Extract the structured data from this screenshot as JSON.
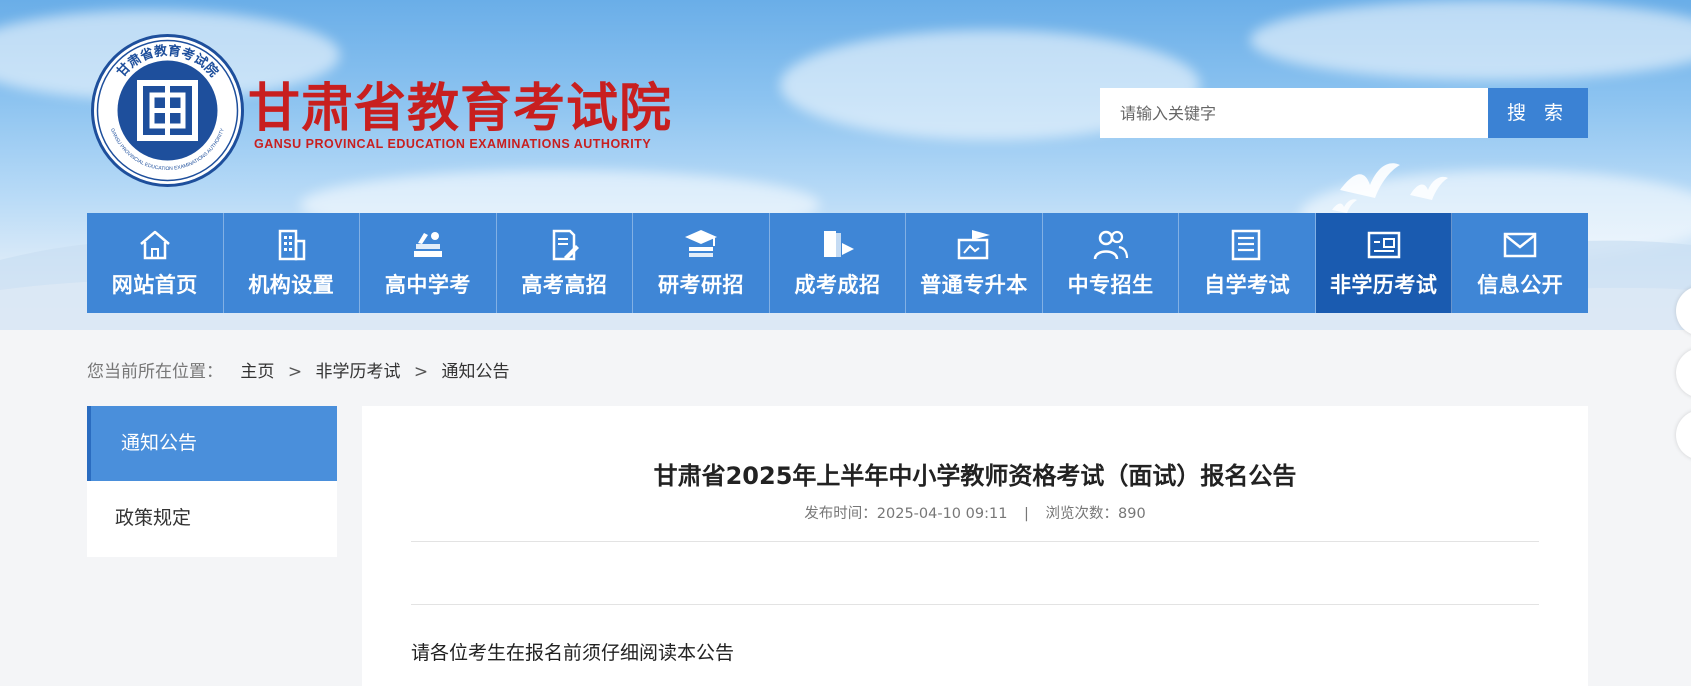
{
  "header": {
    "site_title": "甘肃省教育考试院",
    "site_subtitle": "GANSU PROVINCAL EDUCATION EXAMINATIONS AUTHORITY",
    "logo_ring_text": "甘肃省教育考试院",
    "logo_ring_text_en": "GANSU PROVINCIAL EDUCATION EXAMINATIONS AUTHORITY",
    "search": {
      "placeholder": "请输入关键字",
      "button_label": "搜 索"
    }
  },
  "nav": {
    "items": [
      {
        "label": "网站首页",
        "icon": "home-icon"
      },
      {
        "label": "机构设置",
        "icon": "building-icon"
      },
      {
        "label": "高中学考",
        "icon": "books-icon"
      },
      {
        "label": "高考高招",
        "icon": "document-pen-icon"
      },
      {
        "label": "研考研招",
        "icon": "graduation-cap-icon"
      },
      {
        "label": "成考成招",
        "icon": "book-flag-icon"
      },
      {
        "label": "普通专升本",
        "icon": "cap-screen-icon"
      },
      {
        "label": "中专招生",
        "icon": "users-icon"
      },
      {
        "label": "自学考试",
        "icon": "notebook-icon"
      },
      {
        "label": "非学历考试",
        "icon": "card-icon",
        "active": true
      },
      {
        "label": "信息公开",
        "icon": "mail-icon"
      }
    ]
  },
  "breadcrumb": {
    "prefix": "您当前所在位置：",
    "items": [
      "主页",
      "非学历考试",
      "通知公告"
    ],
    "separator": ">"
  },
  "sidebar": {
    "items": [
      {
        "label": "通知公告",
        "active": true
      },
      {
        "label": "政策规定"
      }
    ]
  },
  "article": {
    "title": "甘肃省2025年上半年中小学教师资格考试（面试）报名公告",
    "publish_label": "发布时间：",
    "publish_time": "2025-04-10 09:11",
    "meta_separator": "|",
    "views_label": "浏览次数：",
    "views": "890",
    "intro": "请各位考生在报名前须仔细阅读本公告"
  },
  "colors": {
    "brand_red": "#c81f1f",
    "nav_blue": "#3f86d6",
    "nav_active": "#1a5bb0",
    "search_button": "#3b82d4"
  }
}
